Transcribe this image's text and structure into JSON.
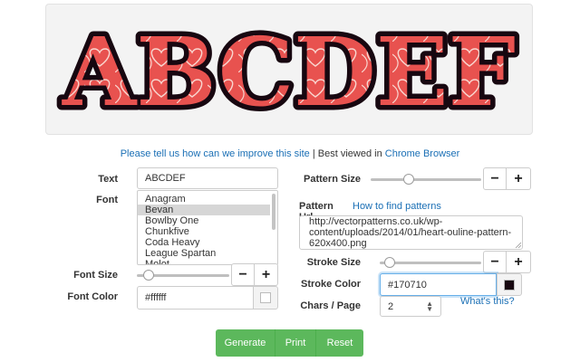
{
  "preview": {
    "text": "ABCDEF",
    "fill_color": "#e8524f",
    "stroke_color": "#170710",
    "pattern_line_color": "#f9d6cf"
  },
  "info": {
    "feedback_link": "Please tell us how can we improve this site",
    "separator": " | ",
    "best_viewed": "Best viewed in ",
    "browser_link": "Chrome Browser"
  },
  "form": {
    "text_label": "Text",
    "text_value": "ABCDEF",
    "font_label": "Font",
    "fonts": [
      "Anagram",
      "Bevan",
      "Bowlby One",
      "Chunkfive",
      "Coda Heavy",
      "League Spartan",
      "Molot"
    ],
    "selected_font": "Bevan",
    "font_size_label": "Font Size",
    "font_size_level": 0.08,
    "font_color_label": "Font Color",
    "font_color_value": "#ffffff",
    "pattern_size_label": "Pattern Size",
    "pattern_size_level": 0.33,
    "pattern_url_label": "Pattern Url",
    "pattern_help_link": "How to find patterns",
    "pattern_url_lines": [
      "http://vectorpatterns.co.uk/wp-",
      "content/uploads/2014/01/heart-ouline-pattern-",
      "620x400.png"
    ],
    "stroke_size_label": "Stroke Size",
    "stroke_size_level": 0.05,
    "stroke_color_label": "Stroke Color",
    "stroke_color_value": "#170710",
    "chars_label": "Chars / Page",
    "chars_value": "2",
    "whats_this": "What's this?",
    "minus": "−",
    "plus": "+"
  },
  "actions": {
    "generate": "Generate",
    "print": "Print",
    "reset": "Reset"
  }
}
